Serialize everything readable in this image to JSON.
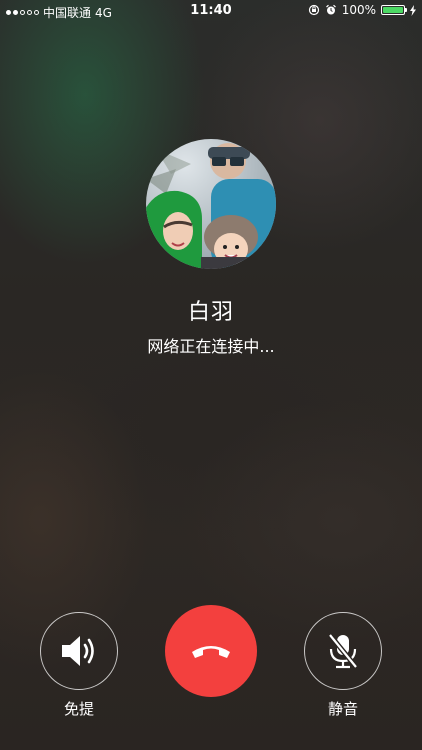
{
  "status_bar": {
    "carrier": "中国联通",
    "network": "4G",
    "time": "11:40",
    "battery_percent": "100%",
    "battery_color": "#4cd964",
    "signal_strength_of_5": 2
  },
  "call": {
    "caller_name": "白羽",
    "status": "网络正在连接中..."
  },
  "controls": {
    "speaker_label": "免提",
    "mute_label": "静音",
    "hangup_color": "#f3403e"
  }
}
